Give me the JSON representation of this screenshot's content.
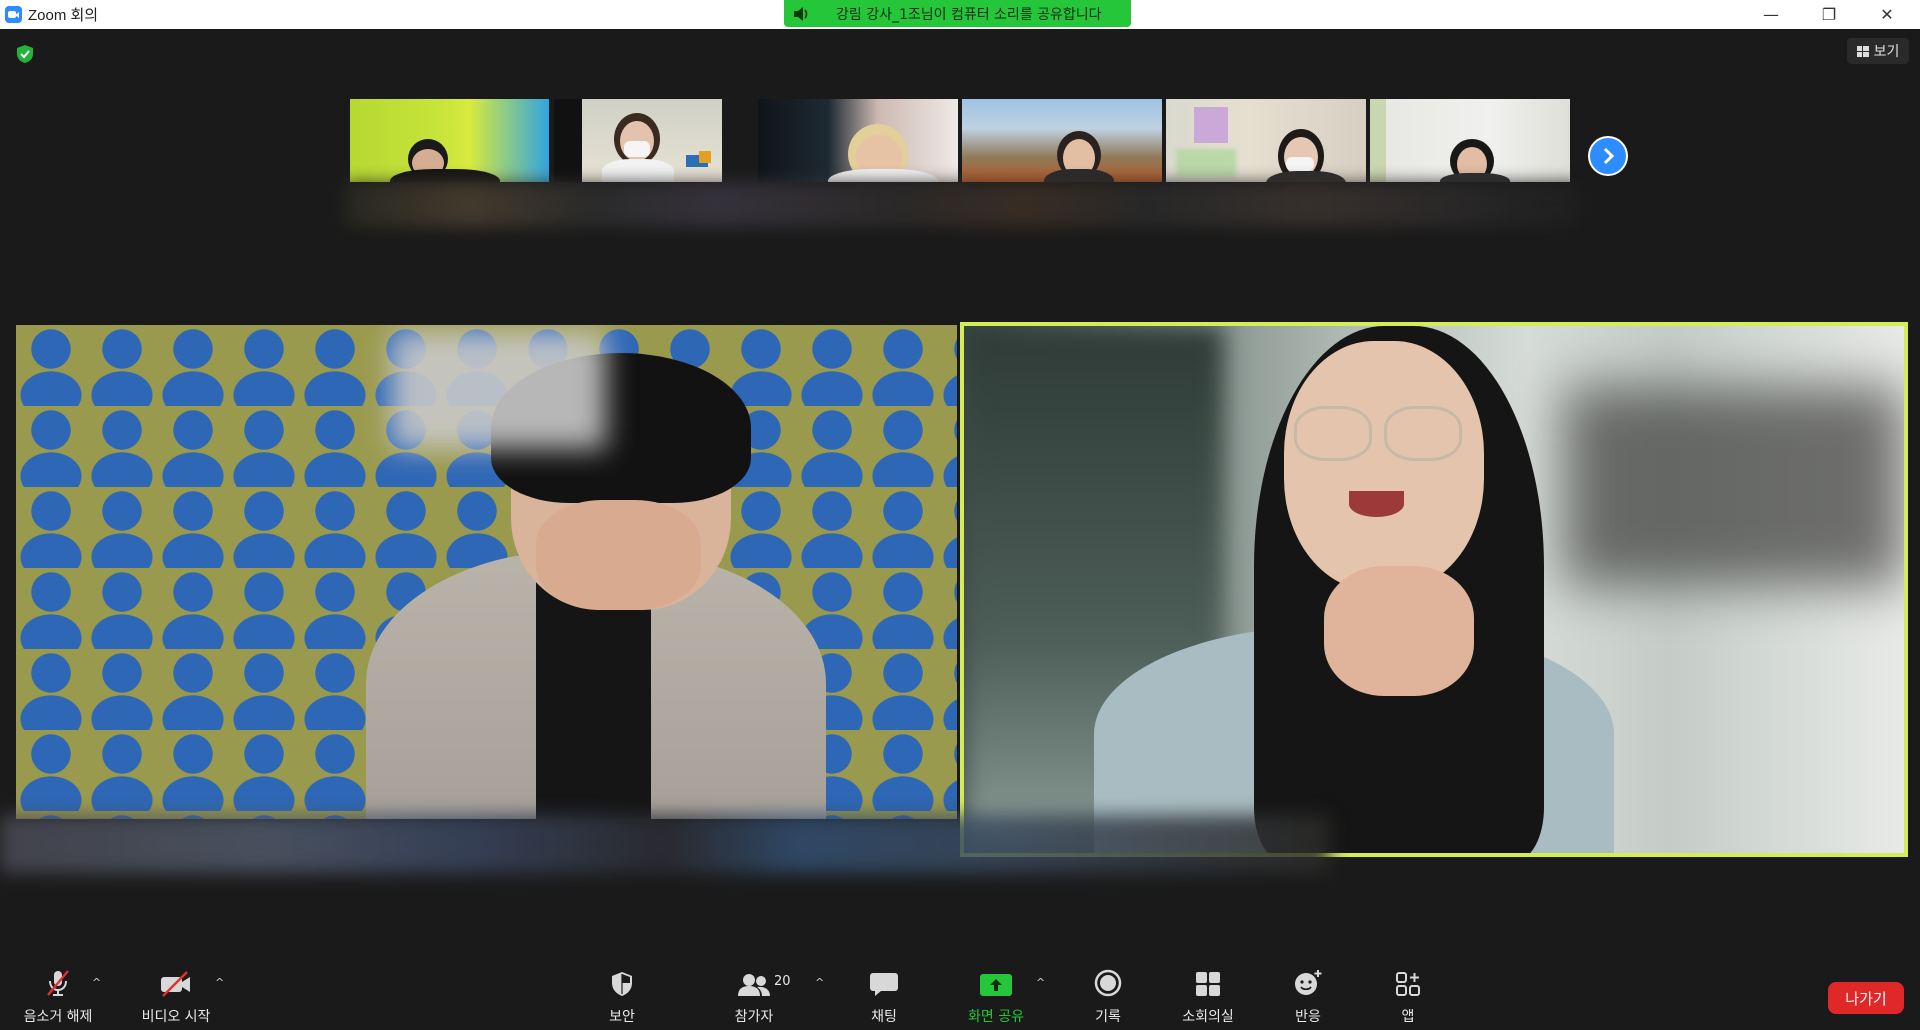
{
  "window": {
    "title": "Zoom 회의",
    "minimize": "—",
    "restore": "❐",
    "close": "✕"
  },
  "sharing_banner": "강림 강사_1조님이 컴퓨터 소리를 공유합니다",
  "view_button": "보기",
  "toolbar": {
    "mute": "음소거 해제",
    "video": "비디오 시작",
    "security": "보안",
    "participants": "참가자",
    "participants_count": "20",
    "chat": "채팅",
    "share": "화면 공유",
    "record": "기록",
    "breakout": "소회의실",
    "reactions": "반응",
    "apps": "앱",
    "leave": "나가기"
  },
  "colors": {
    "active_speaker_border": "#d4ec58",
    "share_green": "#25c63a",
    "leave_red": "#e02828",
    "accent_blue": "#2d8cff"
  }
}
